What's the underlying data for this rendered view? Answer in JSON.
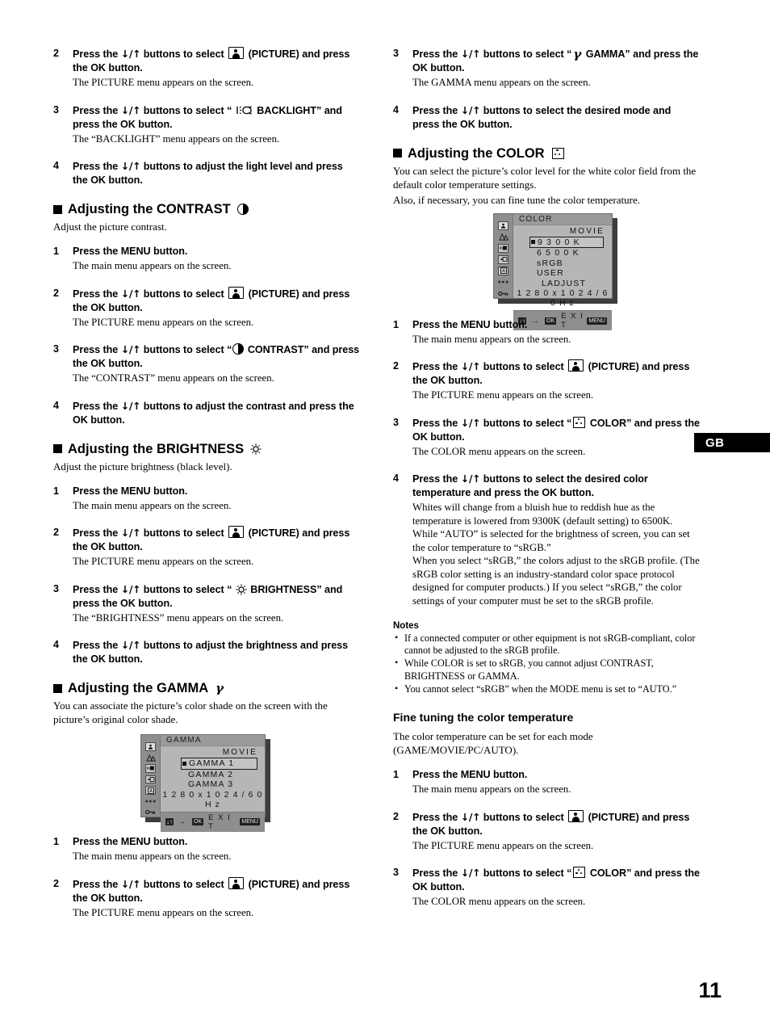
{
  "page": {
    "number": "11",
    "locale_tab": "GB"
  },
  "icons": {
    "picture": "picture-icon",
    "contrast": "contrast-icon",
    "brightness": "brightness-icon",
    "backlight": "backlight-icon",
    "gamma": "γ",
    "color": "color-icon"
  },
  "left_column": {
    "steps_top": [
      {
        "num": "2",
        "head_pre": "Press the ",
        "arrows": "↓/↑",
        "head_mid": " buttons to select ",
        "icon": "picture",
        "head_post": " (PICTURE) and press the OK button.",
        "body": "The PICTURE menu appears on the screen."
      },
      {
        "num": "3",
        "head_pre": "Press the ",
        "arrows": "↓/↑",
        "head_mid": " buttons to select “ ",
        "icon": "backlight",
        "head_post": " BACKLIGHT” and press the OK button.",
        "body": "The “BACKLIGHT” menu appears on the screen."
      },
      {
        "num": "4",
        "head_pre": "Press the ",
        "arrows": "↓/↑",
        "head_mid": " buttons to adjust the light level and press the OK button.",
        "icon": "",
        "head_post": "",
        "body": ""
      }
    ],
    "contrast_section": {
      "heading": "Adjusting the CONTRAST",
      "heading_icon": "contrast",
      "intro": "Adjust the picture contrast.",
      "steps": [
        {
          "num": "1",
          "head_pre": "Press the MENU button.",
          "arrows": "",
          "head_mid": "",
          "icon": "",
          "head_post": "",
          "body": "The main menu appears on the screen."
        },
        {
          "num": "2",
          "head_pre": "Press the ",
          "arrows": "↓/↑",
          "head_mid": " buttons to select ",
          "icon": "picture",
          "head_post": " (PICTURE) and press the OK button.",
          "body": "The PICTURE menu appears on the screen."
        },
        {
          "num": "3",
          "head_pre": "Press the ",
          "arrows": "↓/↑",
          "head_mid": " buttons to select “",
          "icon": "contrast",
          "head_post": " CONTRAST” and press the OK button.",
          "body": "The “CONTRAST” menu appears on the screen."
        },
        {
          "num": "4",
          "head_pre": "Press the ",
          "arrows": "↓/↑",
          "head_mid": " buttons to adjust the contrast and press the OK button.",
          "icon": "",
          "head_post": "",
          "body": ""
        }
      ]
    },
    "brightness_section": {
      "heading": "Adjusting the BRIGHTNESS",
      "heading_icon": "brightness",
      "intro": "Adjust the picture brightness (black level).",
      "steps": [
        {
          "num": "1",
          "head_pre": "Press the MENU button.",
          "arrows": "",
          "head_mid": "",
          "icon": "",
          "head_post": "",
          "body": "The main menu appears on the screen."
        },
        {
          "num": "2",
          "head_pre": "Press the ",
          "arrows": "↓/↑",
          "head_mid": " buttons to select ",
          "icon": "picture",
          "head_post": " (PICTURE) and press the OK button.",
          "body": "The PICTURE menu appears on the screen."
        },
        {
          "num": "3",
          "head_pre": "Press the ",
          "arrows": "↓/↑",
          "head_mid": " buttons to select “ ",
          "icon": "brightness",
          "head_post": " BRIGHTNESS” and press the OK button.",
          "body": "The “BRIGHTNESS” menu appears on the screen."
        },
        {
          "num": "4",
          "head_pre": "Press the ",
          "arrows": "↓/↑",
          "head_mid": " buttons to adjust the brightness and press the OK button.",
          "icon": "",
          "head_post": "",
          "body": ""
        }
      ]
    },
    "gamma_section": {
      "heading": "Adjusting the GAMMA",
      "heading_icon": "gamma",
      "intro": "You can associate the picture’s color shade on the screen with the picture’s original color shade.",
      "steps": [
        {
          "num": "1",
          "head_pre": "Press the MENU button.",
          "arrows": "",
          "head_mid": "",
          "icon": "",
          "head_post": "",
          "body": "The main menu appears on the screen."
        },
        {
          "num": "2",
          "head_pre": "Press the ",
          "arrows": "↓/↑",
          "head_mid": " buttons to select ",
          "icon": "picture",
          "head_post": " (PICTURE) and press the OK button.",
          "body": "The PICTURE menu appears on the screen."
        }
      ]
    }
  },
  "right_column": {
    "steps_top": [
      {
        "num": "3",
        "head_pre": "Press the ",
        "arrows": "↓/↑",
        "head_mid": " buttons to select “",
        "icon": "gamma",
        "head_post": " GAMMA” and press the OK button.",
        "body": "The GAMMA menu appears on the screen."
      },
      {
        "num": "4",
        "head_pre": "Press the ",
        "arrows": "↓/↑",
        "head_mid": " buttons to select the desired mode and press the OK button.",
        "icon": "",
        "head_post": "",
        "body": ""
      }
    ],
    "color_section": {
      "heading": "Adjusting the COLOR",
      "heading_icon": "color",
      "intro_1": "You can select the picture’s color level for the white color field from the default color temperature settings.",
      "intro_2": "Also, if necessary, you can fine tune the color temperature.",
      "steps": [
        {
          "num": "1",
          "head_pre": "Press the MENU button.",
          "arrows": "",
          "head_mid": "",
          "icon": "",
          "head_post": "",
          "body": "The main menu appears on the screen."
        },
        {
          "num": "2",
          "head_pre": "Press the ",
          "arrows": "↓/↑",
          "head_mid": " buttons to select ",
          "icon": "picture",
          "head_post": " (PICTURE) and press the OK button.",
          "body": "The PICTURE menu appears on the screen."
        },
        {
          "num": "3",
          "head_pre": "Press the ",
          "arrows": "↓/↑",
          "head_mid": " buttons to select “",
          "icon": "color",
          "head_post": " COLOR” and press the OK button.",
          "body": "The COLOR menu appears on the screen."
        },
        {
          "num": "4",
          "head_pre": "Press the ",
          "arrows": "↓/↑",
          "head_mid": " buttons to select the desired color temperature and press the OK button.",
          "icon": "",
          "head_post": "",
          "body": "Whites will change from a bluish hue to reddish hue as the temperature is lowered from 9300K (default setting) to 6500K.\nWhile “AUTO” is selected for the brightness of screen, you can set the color temperature to “sRGB.”\nWhen you select “sRGB,” the colors adjust to the sRGB profile. (The sRGB color setting is an industry-standard color space protocol designed for computer products.) If you select “sRGB,” the color settings of your computer must be set to the sRGB profile."
        }
      ]
    },
    "notes": {
      "title": "Notes",
      "bullet": "•",
      "items": [
        "If a connected computer or other equipment is not sRGB-compliant, color cannot be adjusted to the sRGB profile.",
        "While COLOR is set to sRGB, you cannot adjust CONTRAST, BRIGHTNESS or GAMMA.",
        "You cannot select “sRGB” when the MODE menu is set to “AUTO.”"
      ]
    },
    "fine_tuning": {
      "heading": "Fine tuning the color temperature",
      "intro": "The color temperature can be set for each mode (GAME/MOVIE/PC/AUTO).",
      "steps": [
        {
          "num": "1",
          "head_pre": "Press the MENU button.",
          "arrows": "",
          "head_mid": "",
          "icon": "",
          "head_post": "",
          "body": "The main menu appears on the screen."
        },
        {
          "num": "2",
          "head_pre": "Press the ",
          "arrows": "↓/↑",
          "head_mid": " buttons to select ",
          "icon": "picture",
          "head_post": " (PICTURE) and press the OK button.",
          "body": "The PICTURE menu appears on the screen."
        },
        {
          "num": "3",
          "head_pre": "Press the ",
          "arrows": "↓/↑",
          "head_mid": " buttons to select “",
          "icon": "color",
          "head_post": " COLOR” and press the OK button.",
          "body": "The COLOR menu appears on the screen."
        }
      ]
    }
  },
  "osd_gamma": {
    "title": "GAMMA",
    "mode": "MOVIE",
    "options": [
      "GAMMA 1",
      "GAMMA 2",
      "GAMMA 3"
    ],
    "selected_index": 0,
    "resolution": "1 2 8 0 x 1 0 2 4 / 6 0 H z",
    "bar": {
      "updown": "↓↑",
      "right": "→",
      "ok": "OK",
      "exit": "E X I T",
      "menu": "MENU"
    },
    "rail_icons": [
      "picture-icon",
      "mountains-icon",
      "screen-position-icon",
      "screen-size-icon",
      "language-icon",
      "menu-position-icon",
      "key-lock-icon"
    ]
  },
  "osd_color": {
    "title": "COLOR",
    "mode": "MOVIE",
    "options": [
      "9 3 0 0 K",
      "6 5 0 0 K",
      "sRGB",
      "USER",
      "LADJUST"
    ],
    "selected_index": 0,
    "resolution": "1 2 8 0 x 1 0 2 4 / 6 0 H z",
    "bar": {
      "updown": "↓↑",
      "right": "→",
      "ok": "OK",
      "exit": "E X I T",
      "menu": "MENU"
    },
    "rail_icons": [
      "picture-icon",
      "mountains-icon",
      "screen-position-icon",
      "screen-size-icon",
      "language-icon",
      "menu-position-icon",
      "key-lock-icon"
    ]
  }
}
